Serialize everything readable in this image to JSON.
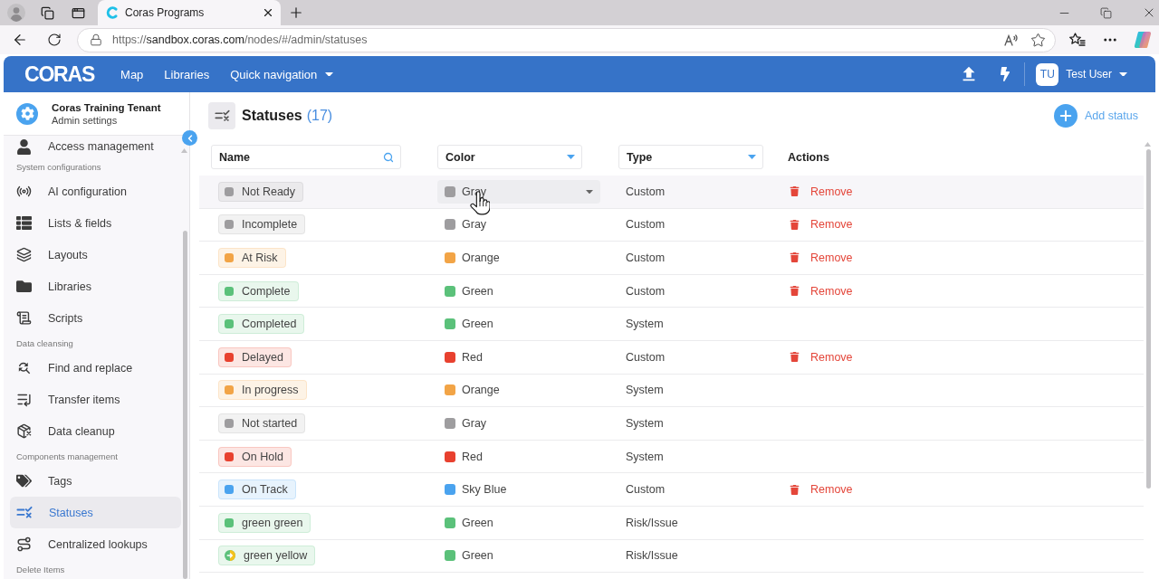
{
  "browser": {
    "tab": {
      "title": "Coras Programs"
    },
    "address": {
      "scheme": "https://",
      "host": "sandbox.coras.com",
      "path": "/nodes/#/admin/statuses"
    }
  },
  "header": {
    "logo": "CORAS",
    "nav": [
      {
        "label": "Map",
        "kind": "link"
      },
      {
        "label": "Libraries",
        "kind": "link"
      },
      {
        "label": "Quick navigation",
        "kind": "menu"
      }
    ],
    "user": {
      "initials": "TU",
      "name": "Test User"
    }
  },
  "sidebar": {
    "title": "Coras Training Tenant",
    "subtitle": "Admin settings",
    "sections": [
      {
        "items": [
          {
            "label": "Access management",
            "selected": false
          }
        ]
      },
      {
        "heading": "System configurations",
        "items": [
          {
            "label": "AI configuration",
            "selected": false
          },
          {
            "label": "Lists & fields",
            "selected": false
          },
          {
            "label": "Layouts",
            "selected": false
          },
          {
            "label": "Libraries",
            "selected": false
          },
          {
            "label": "Scripts",
            "selected": false
          }
        ]
      },
      {
        "heading": "Data cleansing",
        "items": [
          {
            "label": "Find and replace",
            "selected": false
          },
          {
            "label": "Transfer items",
            "selected": false
          },
          {
            "label": "Data cleanup",
            "selected": false
          }
        ]
      },
      {
        "heading": "Components management",
        "items": [
          {
            "label": "Tags",
            "selected": false
          },
          {
            "label": "Statuses",
            "selected": true
          },
          {
            "label": "Centralized lookups",
            "selected": false
          }
        ]
      },
      {
        "heading": "Delete Items"
      }
    ]
  },
  "page": {
    "title": "Statuses",
    "count": "(17)",
    "add_button": "Add status"
  },
  "table": {
    "columns": [
      {
        "label": "Name",
        "kind": "search"
      },
      {
        "label": "Color",
        "kind": "select"
      },
      {
        "label": "Type",
        "kind": "select"
      },
      {
        "label": "Actions",
        "kind": "plain"
      }
    ],
    "rows": [
      {
        "kind": "solid",
        "name": "Not Ready",
        "color": "#9e9d9f",
        "color_name": "Gray",
        "type": "Custom",
        "action": "Remove",
        "hovered": true
      },
      {
        "kind": "solid",
        "name": "Incomplete",
        "color": "#9e9d9f",
        "color_name": "Gray",
        "type": "Custom",
        "action": "Remove",
        "hovered": false
      },
      {
        "kind": "solid",
        "name": "At Risk",
        "color": "#f2a446",
        "color_name": "Orange",
        "type": "Custom",
        "action": "Remove",
        "hovered": false
      },
      {
        "kind": "solid",
        "name": "Complete",
        "color": "#5bc17a",
        "color_name": "Green",
        "type": "Custom",
        "action": "Remove",
        "hovered": false
      },
      {
        "kind": "solid",
        "name": "Completed",
        "color": "#5bc17a",
        "color_name": "Green",
        "type": "System",
        "hovered": false
      },
      {
        "kind": "solid",
        "name": "Delayed",
        "color": "#e8412f",
        "color_name": "Red",
        "type": "Custom",
        "action": "Remove",
        "hovered": false
      },
      {
        "kind": "solid",
        "name": "In progress",
        "color": "#f2a446",
        "color_name": "Orange",
        "type": "System",
        "hovered": false
      },
      {
        "kind": "solid",
        "name": "Not started",
        "color": "#9e9d9f",
        "color_name": "Gray",
        "type": "System",
        "hovered": false
      },
      {
        "kind": "solid",
        "name": "On Hold",
        "color": "#e8412f",
        "color_name": "Red",
        "type": "System",
        "hovered": false
      },
      {
        "kind": "solid",
        "name": "On Track",
        "color": "#4aa3ef",
        "color_name": "Sky Blue",
        "type": "Custom",
        "action": "Remove",
        "hovered": false
      },
      {
        "kind": "solid",
        "name": "green green",
        "color": "#5bc17a",
        "color_name": "Green",
        "type": "Risk/Issue",
        "hovered": false
      },
      {
        "kind": "split",
        "name": "green yellow",
        "color": "#5bc17a",
        "color_name": "Green",
        "type": "Risk/Issue",
        "hovered": false
      }
    ]
  }
}
